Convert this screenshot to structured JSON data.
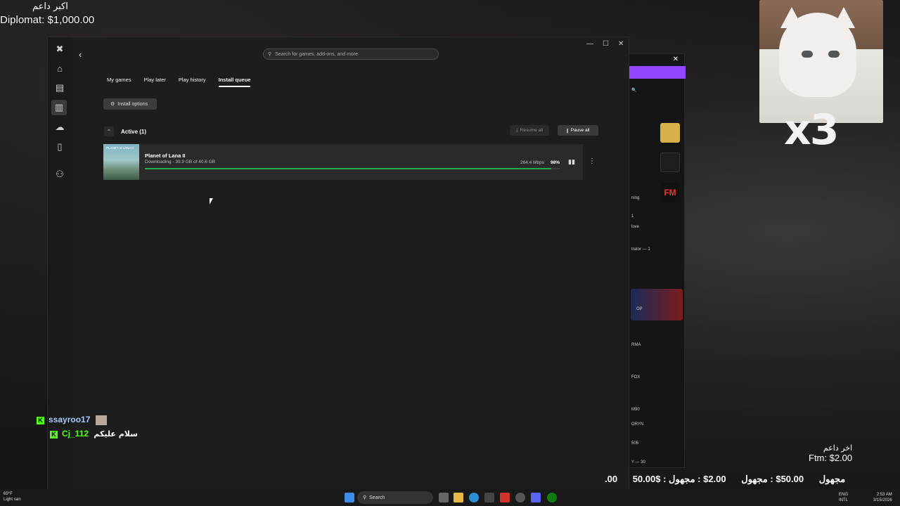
{
  "overlay": {
    "top_line1": "اكبر داعم",
    "top_line2": "Diplomat: $1,000.00",
    "cat_text": "x3"
  },
  "window": {
    "controls": [
      "—",
      "☐",
      "✕"
    ],
    "search_placeholder": "Search for games, add-ons, and more",
    "tabs": [
      "My games",
      "Play later",
      "Play history",
      "Install queue"
    ],
    "active_tab": "Install queue",
    "install_options_label": "Install options",
    "section_title": "Active (1)",
    "resume_all_label": "Resume all",
    "pause_all_label": "Pause all",
    "item": {
      "title": "Planet of Lana II",
      "status": "Downloading - 39.9 GB of 40.6 GB",
      "speed": "264.4 Mbps",
      "percent": "98%",
      "progress": 0.98,
      "thumb_text": "PLANET of LANA II"
    }
  },
  "side_app": {
    "lines": [
      "ning",
      "1",
      "love",
      "trator — 1",
      "RMA",
      "FOX",
      "M90",
      "ORYN",
      "505",
      "Y — 30",
      "OP"
    ],
    "tile_text": "FM"
  },
  "chat": [
    {
      "user": "ssayroo17",
      "color": "#a8c8ff",
      "message": ""
    },
    {
      "user": "Cj_112",
      "color": "#53fc18",
      "message": "سلام عليكم"
    }
  ],
  "ticker": [
    ".00",
    "50.00$ : مجهول",
    "50.00$ : مجهول",
    "2.00$ : مجهول"
  ],
  "donor": {
    "label": "اخر داعم",
    "value": "Ftm: $2.00"
  },
  "taskbar": {
    "search_label": "Search",
    "weather_temp": "69°F",
    "weather_desc": "Light rain",
    "lang": "ENG",
    "lang2": "INTL",
    "time": "2:53 AM",
    "date": "3/15/2026"
  },
  "colors": {
    "progress": "#2aa44a",
    "twitch": "#9146ff",
    "kick": "#53fc18"
  }
}
